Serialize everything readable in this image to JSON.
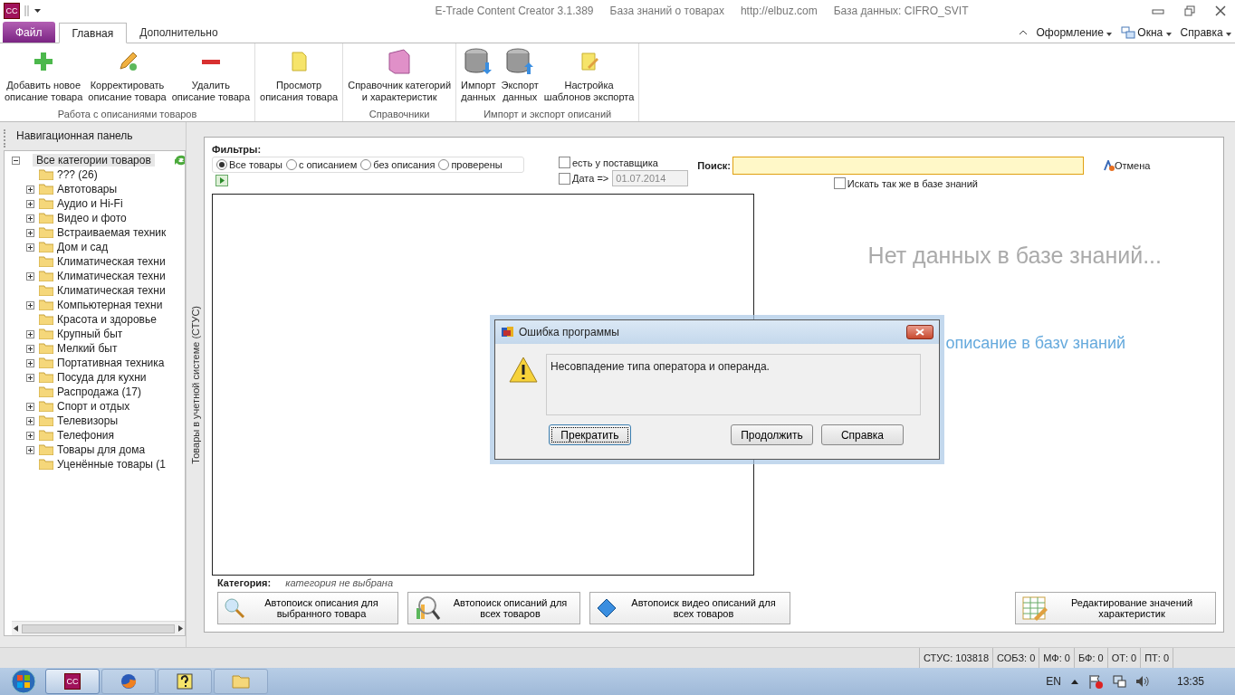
{
  "window": {
    "logo": "CC",
    "title": "E-Trade Content Creator 3.1.389",
    "subtitle": "База знаний о товарах",
    "site": "http://elbuz.com",
    "database": "База данных: CIFRO_SVIT"
  },
  "file_menu": "Файл",
  "tabs": [
    {
      "label": "Главная",
      "selected": true,
      "kind": "tab"
    },
    {
      "label": "Дополнительно",
      "selected": false,
      "kind": "tab"
    }
  ],
  "right_menu": [
    "Оформление",
    "Окна",
    "Справка"
  ],
  "ribbon_groups": [
    {
      "title": "Работа с описаниями товаров",
      "buttons": [
        "Добавить новое\nописание товара",
        "Корректировать\nописание товара",
        "Удалить\nописание товара"
      ]
    },
    {
      "buttons": [
        "Просмотр\nописания товара"
      ]
    },
    {
      "title": "Справочники",
      "buttons": [
        "Справочник категорий\nи характеристик"
      ]
    },
    {
      "title": "Импорт и экспорт описаний",
      "buttons": [
        "Импорт\nданных",
        "Экспорт\nданных",
        "Настройка\nшаблонов экспорта"
      ]
    }
  ],
  "nav_panel": {
    "title": "Навигационная панель",
    "vertical_tab": "Товары в учетной системе (СТУС)",
    "tree": {
      "label": "Все категории товаров",
      "expanded": true,
      "selected": true,
      "children": [
        {
          "label": "??? (26)",
          "has_children": false,
          "selected": false
        },
        {
          "label": "Автотовары",
          "has_children": true,
          "selected": false
        },
        {
          "label": "Аудио и Hi-Fi",
          "has_children": true,
          "selected": false
        },
        {
          "label": "Видео и фото",
          "has_children": true,
          "selected": false
        },
        {
          "label": "Встраиваемая техник",
          "has_children": true,
          "selected": false
        },
        {
          "label": "Дом и сад",
          "has_children": true,
          "selected": false
        },
        {
          "label": "Климатическая техни",
          "has_children": false,
          "selected": false
        },
        {
          "label": "Климатическая техни",
          "has_children": true,
          "selected": false
        },
        {
          "label": "Климатическая техни",
          "has_children": false,
          "selected": false
        },
        {
          "label": "Компьютерная техни",
          "has_children": true,
          "selected": false
        },
        {
          "label": "Красота и здоровье",
          "has_children": false,
          "selected": false
        },
        {
          "label": "Крупный быт",
          "has_children": true,
          "selected": false
        },
        {
          "label": "Мелкий быт",
          "has_children": true,
          "selected": false
        },
        {
          "label": "Портативная техника",
          "has_children": true,
          "selected": false
        },
        {
          "label": "Посуда для кухни",
          "has_children": true,
          "selected": false
        },
        {
          "label": "Распродажа (17)",
          "has_children": false,
          "selected": false
        },
        {
          "label": "Спорт и отдых",
          "has_children": true,
          "selected": false
        },
        {
          "label": "Телевизоры",
          "has_children": true,
          "selected": false
        },
        {
          "label": "Телефония",
          "has_children": true,
          "selected": false
        },
        {
          "label": "Товары для дома",
          "has_children": true,
          "selected": false
        },
        {
          "label": "Уценённые товары (1",
          "has_children": false,
          "selected": false
        }
      ]
    }
  },
  "filters": {
    "title": "Фильтры:",
    "options": [
      {
        "label": "Все товары",
        "selected": true
      },
      {
        "label": "с описанием",
        "selected": false
      },
      {
        "label": "без описания",
        "selected": false
      },
      {
        "label": "проверены",
        "selected": false
      }
    ]
  },
  "supplier_check": {
    "label": "есть у поставщика",
    "checked": false
  },
  "date_check": {
    "label": "Дата =>",
    "checked": false,
    "value": "01.07.2014"
  },
  "search": {
    "label": "Поиск:",
    "cancel": "Отмена",
    "also_kb": {
      "label": "Искать так же в базе знаний",
      "checked": false
    }
  },
  "kb_message": "Нет данных в базе знаний...",
  "kb_link": "описание в базv знаний",
  "category": {
    "label": "Категория:",
    "value": "категория не выбрана"
  },
  "actions": [
    "Автопоиск описания для\nвыбранного товара",
    "Автопоиск описаний для\nвсех товаров",
    "Автопоиск видео описаний для\nвсех товаров"
  ],
  "edit_values": "Редактирование значений\nхарактеристик",
  "status_bar": [
    "СТУС: 103818",
    "СОБЗ: 0",
    "МФ: 0",
    "БФ: 0",
    "ОТ: 0",
    "ПТ: 0"
  ],
  "dialog": {
    "title": "Ошибка программы",
    "message": "Несовпадение типа оператора и операнда.",
    "buttons": [
      {
        "label": "Прекратить",
        "selected": true
      },
      {
        "label": "Продолжить",
        "selected": false
      },
      {
        "label": "Справка",
        "selected": false
      }
    ]
  },
  "taskbar": {
    "items": [
      {
        "label": "CC",
        "selected": true
      },
      {
        "selected": false
      },
      {
        "selected": false
      },
      {
        "selected": false
      }
    ],
    "language": "EN",
    "time": "13:35"
  }
}
